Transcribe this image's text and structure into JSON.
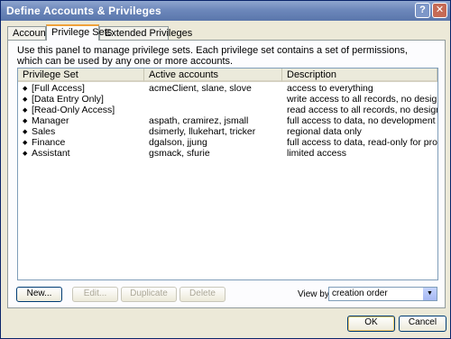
{
  "window": {
    "title": "Define Accounts & Privileges",
    "help_glyph": "?",
    "close_glyph": "✕"
  },
  "tabs": [
    {
      "label": "Accounts",
      "active": false
    },
    {
      "label": "Privilege Sets",
      "active": true
    },
    {
      "label": "Extended Privileges",
      "active": false
    }
  ],
  "instructions": "Use this panel to manage privilege sets.  Each privilege set contains a set of permissions, which can be used by any one or more accounts.",
  "table": {
    "columns": [
      "Privilege Set",
      "Active accounts",
      "Description"
    ],
    "rows": [
      {
        "name": "[Full Access]",
        "accounts": "acmeClient, slane, slove",
        "description": "access to everything"
      },
      {
        "name": "[Data Entry Only]",
        "accounts": "",
        "description": "write access to all records, no design access"
      },
      {
        "name": "[Read-Only Access]",
        "accounts": "",
        "description": "read access to all records, no design access"
      },
      {
        "name": "Manager",
        "accounts": "aspath, cramirez, jsmall",
        "description": "full access to data, no development"
      },
      {
        "name": "Sales",
        "accounts": "dsimerly, llukehart, tricker",
        "description": "regional data only"
      },
      {
        "name": "Finance",
        "accounts": "dgalson, jjung",
        "description": "full access to data, read-only for products"
      },
      {
        "name": "Assistant",
        "accounts": "gsmack, sfurie",
        "description": "limited access"
      }
    ]
  },
  "buttons": {
    "new": "New...",
    "edit": "Edit...",
    "duplicate": "Duplicate",
    "delete": "Delete",
    "ok": "OK",
    "cancel": "Cancel"
  },
  "view_by": {
    "label": "View by:",
    "value": "creation order"
  },
  "icons": {
    "row_bullet": "◆",
    "dropdown": "▼"
  }
}
